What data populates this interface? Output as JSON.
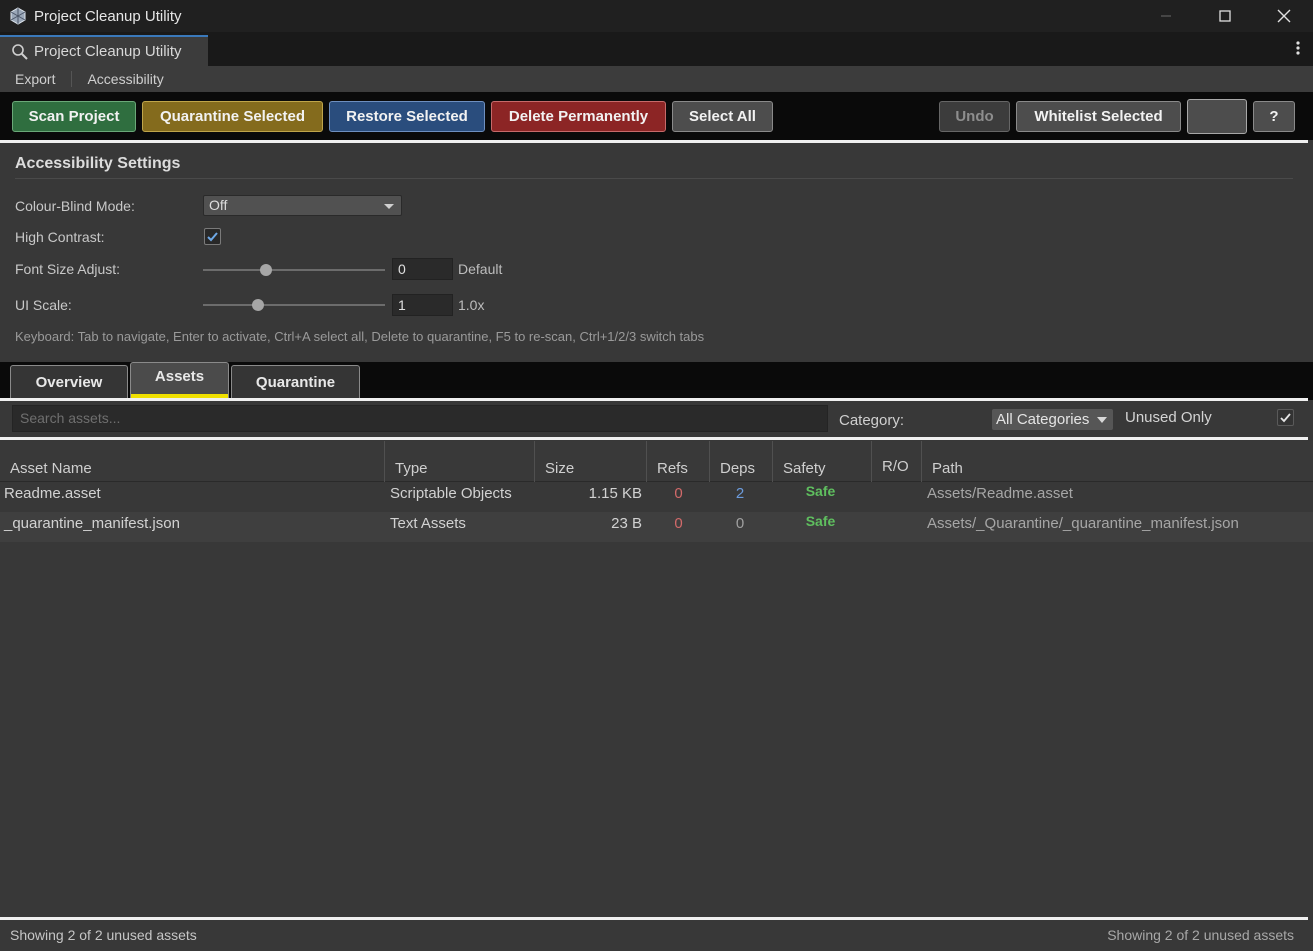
{
  "window": {
    "title": "Project Cleanup Utility"
  },
  "tab": {
    "label": "Project Cleanup Utility"
  },
  "menu": [
    "Export",
    "Accessibility"
  ],
  "toolbar": {
    "scan": "Scan Project",
    "quarantine": "Quarantine Selected",
    "restore": "Restore Selected",
    "delete": "Delete Permanently",
    "select_all": "Select All",
    "undo": "Undo",
    "whitelist": "Whitelist Selected",
    "help": "?"
  },
  "accessibility": {
    "title": "Accessibility Settings",
    "colour_blind_label": "Colour-Blind Mode:",
    "colour_blind_value": "Off",
    "high_contrast_label": "High Contrast:",
    "high_contrast_checked": true,
    "font_size_label": "Font Size Adjust:",
    "font_size_value": "0",
    "font_size_suffix": "Default",
    "ui_scale_label": "UI Scale:",
    "ui_scale_value": "1",
    "ui_scale_suffix": "1.0x",
    "hint": "Keyboard: Tab to navigate, Enter to activate, Ctrl+A select all, Delete to quarantine, F5 to re-scan, Ctrl+1/2/3 switch tabs"
  },
  "panel_tabs": [
    "Overview",
    "Assets",
    "Quarantine"
  ],
  "active_tab": "Assets",
  "filter": {
    "search_placeholder": "Search assets...",
    "category_label": "Category:",
    "category_value": "All Categories",
    "unused_only_label": "Unused Only",
    "unused_only_checked": true
  },
  "table": {
    "columns": [
      "Asset Name",
      "Type",
      "Size",
      "Refs",
      "Deps",
      "Safety",
      "R/O",
      "Path"
    ],
    "rows": [
      {
        "name": "Readme.asset",
        "type": "Scriptable Objects",
        "size": "1.15 KB",
        "refs": "0",
        "deps": "2",
        "safety": "Safe",
        "ro": "",
        "path": "Assets/Readme.asset"
      },
      {
        "name": "_quarantine_manifest.json",
        "type": "Text Assets",
        "size": "23 B",
        "refs": "0",
        "deps": "0",
        "safety": "Safe",
        "ro": "",
        "path": "Assets/_Quarantine/_quarantine_manifest.json"
      }
    ]
  },
  "status": {
    "left": "Showing 2 of 2 unused assets",
    "right": "Showing 2 of 2 unused assets"
  },
  "colors": {
    "accent_tab_underline": "#f0e000",
    "safe": "#5fbf5f",
    "refs_zero": "#d26a6a",
    "deps_nonzero": "#6c9bdc"
  }
}
